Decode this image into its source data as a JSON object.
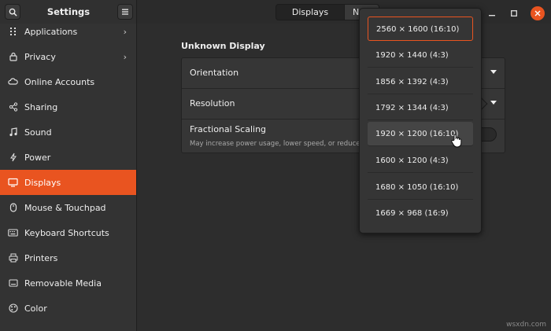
{
  "header": {
    "title": "Settings",
    "tabs": [
      "Displays",
      "N"
    ]
  },
  "sidebar": {
    "items": [
      {
        "label": "Applications",
        "icon": "grid-icon",
        "chevron": true
      },
      {
        "label": "Privacy",
        "icon": "lock-icon",
        "chevron": true
      },
      {
        "label": "Online Accounts",
        "icon": "cloud-icon",
        "chevron": false
      },
      {
        "label": "Sharing",
        "icon": "share-icon",
        "chevron": false
      },
      {
        "label": "Sound",
        "icon": "music-note-icon",
        "chevron": false
      },
      {
        "label": "Power",
        "icon": "power-icon",
        "chevron": false
      },
      {
        "label": "Displays",
        "icon": "display-icon",
        "chevron": false,
        "active": true
      },
      {
        "label": "Mouse & Touchpad",
        "icon": "mouse-icon",
        "chevron": false
      },
      {
        "label": "Keyboard Shortcuts",
        "icon": "keyboard-icon",
        "chevron": false
      },
      {
        "label": "Printers",
        "icon": "printer-icon",
        "chevron": false
      },
      {
        "label": "Removable Media",
        "icon": "media-icon",
        "chevron": false
      },
      {
        "label": "Color",
        "icon": "palette-icon",
        "chevron": false
      }
    ]
  },
  "main": {
    "section_title": "Unknown Display",
    "rows": {
      "orientation": "Orientation",
      "resolution": "Resolution",
      "scaling": "Fractional Scaling",
      "scaling_sub": "May increase power usage, lower speed, or reduce displ"
    }
  },
  "resolution_popover": {
    "options": [
      "2560 × 1600 (16:10)",
      "1920 × 1440 (4:3)",
      "1856 × 1392 (4:3)",
      "1792 × 1344 (4:3)",
      "1920 × 1200 (16:10)",
      "1600 × 1200 (4:3)",
      "1680 × 1050 (16:10)",
      "1669 × 968 (16:9)"
    ],
    "selected_index": 0,
    "hover_index": 4
  },
  "watermark": "wsxdn.com",
  "colors": {
    "accent": "#e95420",
    "background": "#2d2d2d",
    "sidebar": "#333333"
  }
}
